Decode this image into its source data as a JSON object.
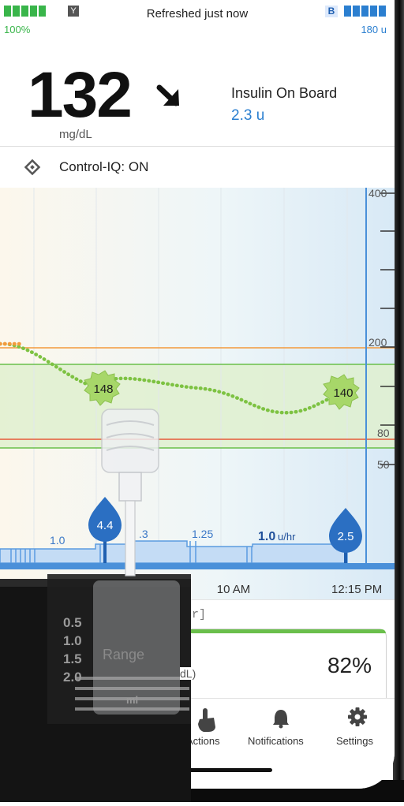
{
  "status_bar": {
    "battery_percent": "100%",
    "refresh_text": "Refreshed just now",
    "insulin_badge": "B",
    "insulin_remaining": "180 u",
    "colors": {
      "battery": "#39b54a",
      "insulin": "#2b7fd0"
    }
  },
  "glucose": {
    "value": "132",
    "unit": "mg/dL",
    "trend_icon": "arrow-down-right-icon"
  },
  "iob": {
    "label": "Insulin On Board",
    "value": "2.3 u"
  },
  "control_iq": {
    "label": "Control-IQ: ON",
    "icon": "diamond-icon"
  },
  "chart": {
    "y_labels": [
      "400",
      "200",
      "80",
      "50"
    ],
    "readings": [
      "148",
      "140"
    ],
    "boluses": [
      "4.4",
      "2.5"
    ],
    "basal_rates": [
      "1.0",
      ".3",
      "1.25",
      "1.0",
      "u/hr"
    ],
    "time_labels": [
      "10 AM",
      "12:15 PM"
    ],
    "colors": {
      "high": "#f39a3c",
      "low": "#e65b3a",
      "target": "#6abf4b",
      "trace": "#7dc242",
      "basal": "#5b9be0"
    }
  },
  "cgm_card": {
    "provider_text": "[CGM Provider]",
    "range_label": "Range",
    "unit_hint": "dL)",
    "percent": "82%"
  },
  "cartridge_scale": [
    "0.5",
    "1.0",
    "1.5",
    "2.0",
    "ml"
  ],
  "nav": {
    "items": [
      {
        "label": "Actions",
        "icon": "hand-tap-icon"
      },
      {
        "label": "Notifications",
        "icon": "bell-icon"
      },
      {
        "label": "Settings",
        "icon": "gear-icon"
      }
    ]
  }
}
